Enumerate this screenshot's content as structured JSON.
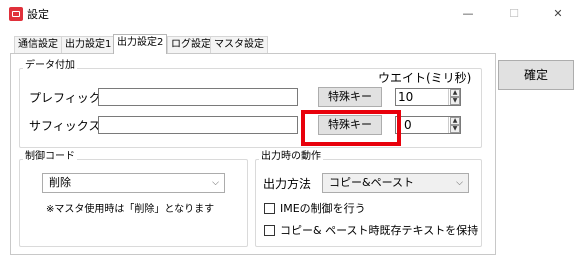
{
  "window": {
    "title": "設定",
    "icon": "settings-app-icon",
    "controls": {
      "minimize": "—",
      "maximize": "☐",
      "close": "✕"
    }
  },
  "tabs": [
    {
      "label": "通信設定",
      "active": false
    },
    {
      "label": "出力設定1",
      "active": false
    },
    {
      "label": "出力設定2",
      "active": true
    },
    {
      "label": "ログ設定",
      "active": false
    },
    {
      "label": "マスタ設定",
      "active": false
    }
  ],
  "data_group": {
    "title": "データ付加",
    "wait_label": "ウエイト(ミリ秒)",
    "prefix": {
      "label": "プレフィックス",
      "value": "",
      "button": "特殊キー",
      "wait": "10"
    },
    "suffix": {
      "label": "サフィックス",
      "value": "",
      "button": "特殊キー",
      "wait": "0"
    }
  },
  "control_group": {
    "title": "制御コード",
    "selected": "削除",
    "note": "※マスタ使用時は「削除」となります"
  },
  "output_group": {
    "title": "出力時の動作",
    "method_label": "出力方法",
    "method_selected": "コピー&ペースト",
    "ime_checkbox": {
      "label": "IMEの制御を行う",
      "checked": false
    },
    "keep_checkbox": {
      "label": "コピー& ペースト時既存テキストを保持",
      "checked": false
    }
  },
  "confirm_button": "確定",
  "colors": {
    "highlight": "#e8000b",
    "app_icon": "#e0303a"
  }
}
